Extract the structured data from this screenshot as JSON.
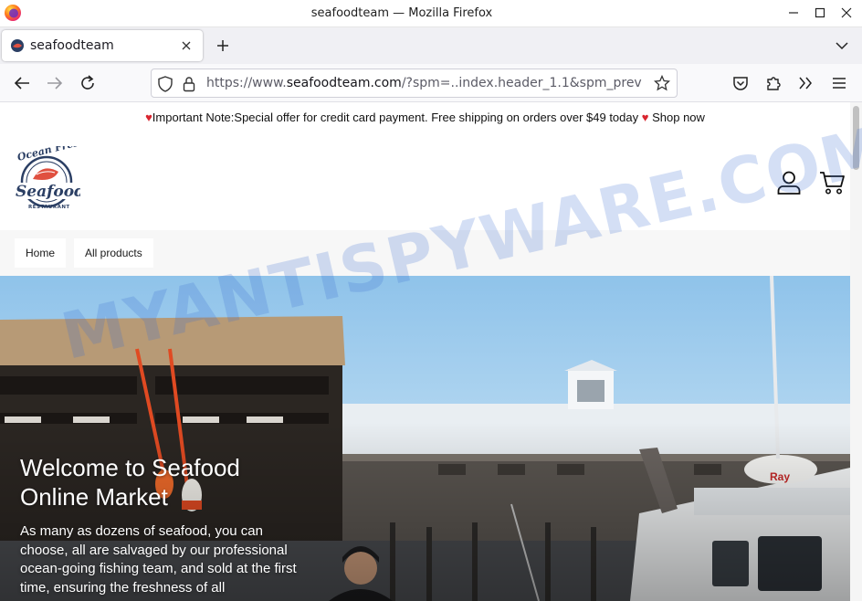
{
  "window": {
    "title": "seafoodteam — Mozilla Firefox"
  },
  "tabs": [
    {
      "label": "seafoodteam",
      "active": true
    }
  ],
  "url": {
    "prefix": "https://www.",
    "domain": "seafoodteam.com",
    "path": "/?spm=..index.header_1.1&spm_prev"
  },
  "announcement": {
    "text": "Important Note:Special offer for credit card payment. Free shipping on orders over $49 today",
    "link": "Shop now"
  },
  "logo": {
    "line1": "Ocean Fresh",
    "line2": "Seafood",
    "line3": "RESTAURANT"
  },
  "menu": [
    {
      "label": "Home"
    },
    {
      "label": "All products"
    }
  ],
  "hero": {
    "title": "Welcome to Seafood Online Market",
    "text": "As many as dozens of seafood, you can choose, all are salvaged by our professional ocean-going fishing team, and sold at the first time, ensuring the freshness of all"
  },
  "watermark": "MYANTISPYWARE.COM",
  "colors": {
    "accent": "#d9252f",
    "logo_blue": "#2b3f64"
  }
}
